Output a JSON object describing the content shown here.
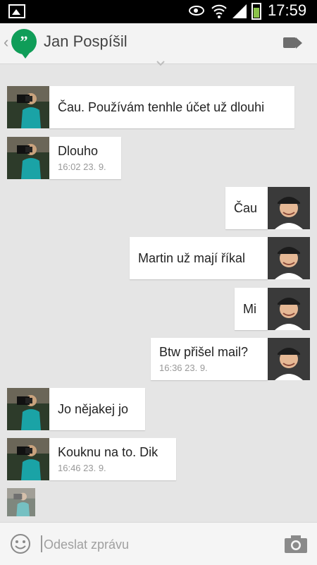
{
  "status_bar": {
    "time": "17:59",
    "icons": [
      "gallery-icon",
      "eye-icon",
      "wifi-icon",
      "signal-icon",
      "battery-icon"
    ]
  },
  "header": {
    "back_glyph": "‹",
    "app_logo_glyph": "”",
    "contact_name": "Jan Pospíšil",
    "video_icon": "video-call-icon"
  },
  "messages": [
    {
      "from": "Jan",
      "text": "Čau. Používám tenhle účet už dlouhi",
      "time": ""
    },
    {
      "from": "Jan",
      "text": "Dlouho",
      "time": "16:02 23. 9."
    },
    {
      "from": "Martin",
      "text": "Čau",
      "time": ""
    },
    {
      "from": "Martin",
      "text": "Martin už mají říkal",
      "time": ""
    },
    {
      "from": "Martin",
      "text": "Mi",
      "time": ""
    },
    {
      "from": "Martin",
      "text": "Btw přišel mail?",
      "time": "16:36 23. 9."
    },
    {
      "from": "Jan",
      "text": "Jo nějakej jo",
      "time": ""
    },
    {
      "from": "Jan",
      "text": "Kouknu na to. Dik",
      "time": "16:46 23. 9."
    }
  ],
  "composer": {
    "placeholder": "Odeslat zprávu",
    "emoji_icon": "emoji-icon",
    "camera_icon": "camera-icon"
  },
  "colors": {
    "hangouts_green": "#0f9d58",
    "background": "#e5e5e5",
    "bubble": "#ffffff"
  }
}
